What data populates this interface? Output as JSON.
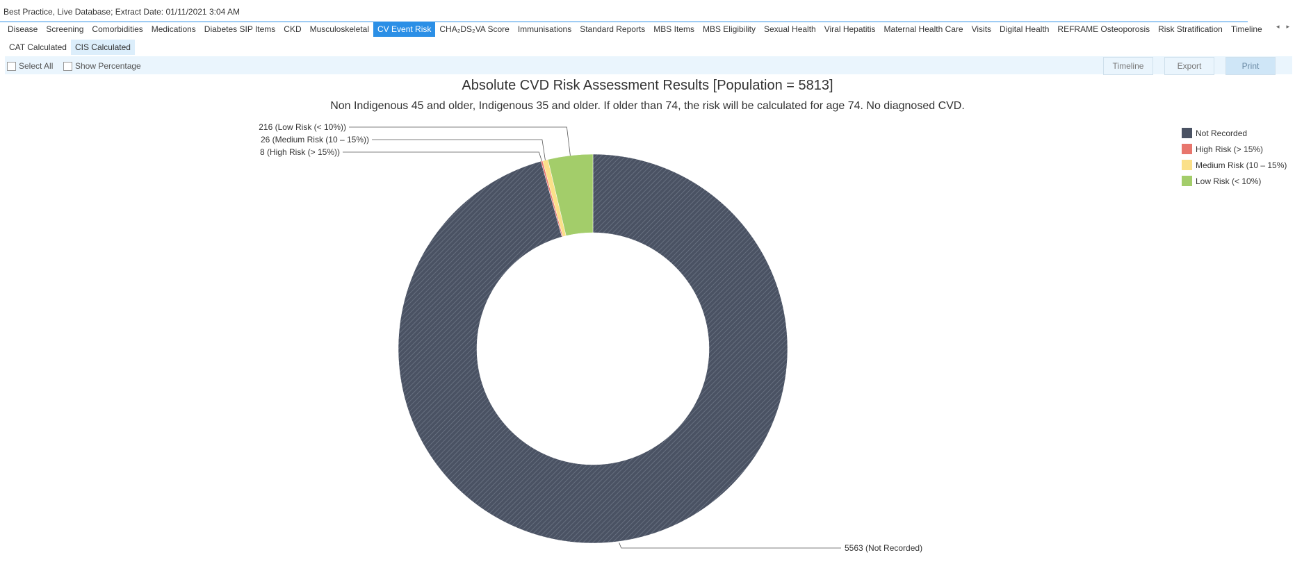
{
  "window": {
    "title": "Best Practice, Live Database; Extract Date: 01/11/2021 3:04 AM"
  },
  "tabs": [
    {
      "label": "Disease",
      "active": false
    },
    {
      "label": "Screening",
      "active": false
    },
    {
      "label": "Comorbidities",
      "active": false
    },
    {
      "label": "Medications",
      "active": false
    },
    {
      "label": "Diabetes SIP Items",
      "active": false
    },
    {
      "label": "CKD",
      "active": false
    },
    {
      "label": "Musculoskeletal",
      "active": false
    },
    {
      "label": "CV Event Risk",
      "active": true
    },
    {
      "label": "CHA₂DS₂VA Score",
      "active": false
    },
    {
      "label": "Immunisations",
      "active": false
    },
    {
      "label": "Standard Reports",
      "active": false
    },
    {
      "label": "MBS Items",
      "active": false
    },
    {
      "label": "MBS Eligibility",
      "active": false
    },
    {
      "label": "Sexual Health",
      "active": false
    },
    {
      "label": "Viral Hepatitis",
      "active": false
    },
    {
      "label": "Maternal Health Care",
      "active": false
    },
    {
      "label": "Visits",
      "active": false
    },
    {
      "label": "Digital Health",
      "active": false
    },
    {
      "label": "REFRAME Osteoporosis",
      "active": false
    },
    {
      "label": "Risk Stratification",
      "active": false
    },
    {
      "label": "Timeline",
      "active": false
    }
  ],
  "tab_scroll": {
    "left_icon": "◂",
    "right_icon": "▸"
  },
  "subtabs": [
    {
      "label": "CAT Calculated",
      "active": false
    },
    {
      "label": "CIS Calculated",
      "active": true
    }
  ],
  "toolbar": {
    "select_all": "Select All",
    "show_percentage": "Show Percentage",
    "timeline_label": "Timeline",
    "export_label": "Export",
    "print_label": "Print"
  },
  "colors": {
    "accent": "#2b8fe6",
    "not_recorded": "#4a5263",
    "high_risk": "#e8766d",
    "medium_risk": "#fbe089",
    "low_risk": "#a3cd6a"
  },
  "chart_data": {
    "type": "pie",
    "style": "donut",
    "title": "Absolute CVD Risk Assessment Results [Population = 5813]",
    "subtitle": "Non Indigenous 45 and older, Indigenous 35 and older. If older than 74, the risk will be calculated for age 74. No diagnosed CVD.",
    "legend_position": "top-right",
    "series": [
      {
        "name": "Not Recorded",
        "value": 5563,
        "label": "5563 (Not Recorded)",
        "color": "#4a5263",
        "pattern": "hatched"
      },
      {
        "name": "High Risk (> 15%)",
        "value": 8,
        "label": "8 (High Risk (> 15%))",
        "color": "#e8766d"
      },
      {
        "name": "Medium Risk (10 – 15%)",
        "value": 26,
        "label": "26 (Medium Risk (10 – 15%))",
        "color": "#fbe089"
      },
      {
        "name": "Low Risk (< 10%)",
        "value": 216,
        "label": "216 (Low Risk (< 10%))",
        "color": "#a3cd6a"
      }
    ]
  }
}
